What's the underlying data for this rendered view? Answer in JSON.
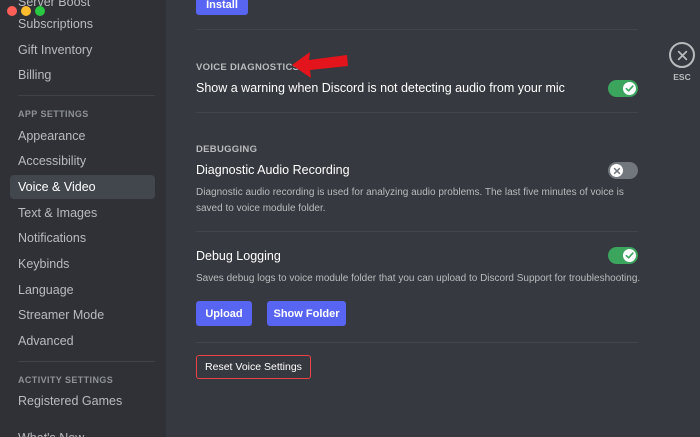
{
  "sidebar": {
    "top_partial": "Server Boost",
    "user_items": [
      "Subscriptions",
      "Gift Inventory",
      "Billing"
    ],
    "app_settings_header": "APP SETTINGS",
    "app_items": [
      "Appearance",
      "Accessibility",
      "Voice & Video",
      "Text & Images",
      "Notifications",
      "Keybinds",
      "Language",
      "Streamer Mode",
      "Advanced"
    ],
    "active_item": "Voice & Video",
    "activity_settings_header": "ACTIVITY SETTINGS",
    "activity_items": [
      "Registered Games"
    ],
    "bottom_partial": "What's New"
  },
  "main": {
    "install_button": "Install",
    "voice_diagnostics": {
      "header": "VOICE DIAGNOSTICS",
      "warning_title": "Show a warning when Discord is not detecting audio from your mic",
      "warning_enabled": true
    },
    "debugging": {
      "header": "DEBUGGING",
      "diag_title": "Diagnostic Audio Recording",
      "diag_desc": "Diagnostic audio recording is used for analyzing audio problems. The last five minutes of voice is saved to voice module folder.",
      "diag_enabled": false,
      "debug_title": "Debug Logging",
      "debug_desc": "Saves debug logs to voice module folder that you can upload to Discord Support for troubleshooting.",
      "debug_enabled": true,
      "upload_button": "Upload",
      "show_folder_button": "Show Folder"
    },
    "reset_button": "Reset Voice Settings"
  },
  "close": {
    "label": "ESC"
  },
  "colors": {
    "blurple": "#5865f2",
    "toggle_on": "#3ba55d",
    "toggle_off": "#72767d",
    "danger": "#ed4245",
    "annotation_arrow": "#e3141b"
  }
}
